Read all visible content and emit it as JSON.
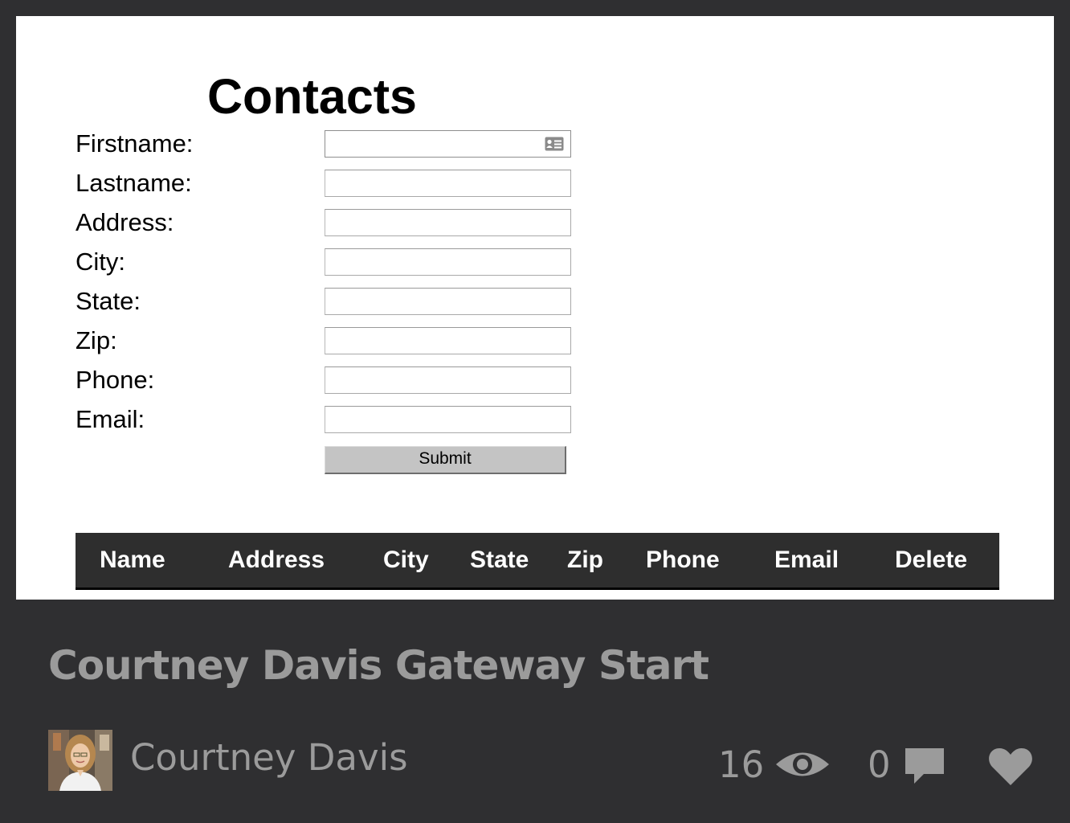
{
  "form": {
    "title": "Contacts",
    "fields": [
      {
        "label": "Firstname:",
        "value": "",
        "placeholder": ""
      },
      {
        "label": "Lastname:",
        "value": "",
        "placeholder": ""
      },
      {
        "label": "Address:",
        "value": "",
        "placeholder": ""
      },
      {
        "label": "City:",
        "value": "",
        "placeholder": ""
      },
      {
        "label": "State:",
        "value": "",
        "placeholder": ""
      },
      {
        "label": "Zip:",
        "value": "",
        "placeholder": ""
      },
      {
        "label": "Phone:",
        "value": "",
        "placeholder": ""
      },
      {
        "label": "Email:",
        "value": "",
        "placeholder": ""
      }
    ],
    "submit_label": "Submit"
  },
  "table": {
    "headers": [
      "Name",
      "Address",
      "City",
      "State",
      "Zip",
      "Phone",
      "Email",
      "Delete"
    ]
  },
  "pen": {
    "title": "Courtney Davis Gateway Start",
    "author": "Courtney Davis",
    "views": "16",
    "comments": "0"
  },
  "icons": {
    "autofill": "contact-card-icon",
    "views": "eye-icon",
    "comments": "comment-icon",
    "like": "heart-icon"
  },
  "colors": {
    "page_bg": "#2f2f31",
    "muted_text": "#9b9b9b",
    "table_header_bg": "#2e2e2e",
    "button_bg": "#c4c4c4"
  }
}
